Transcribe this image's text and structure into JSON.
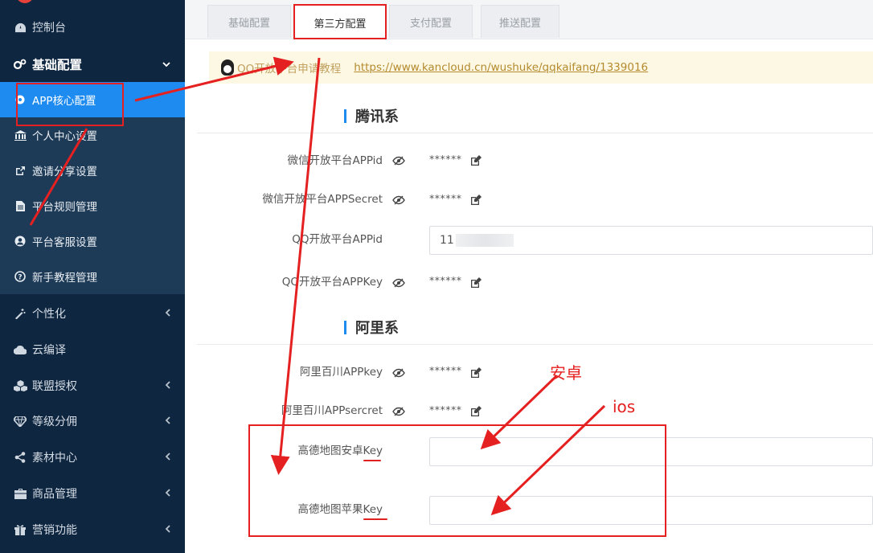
{
  "sidebar": {
    "items": [
      {
        "label": "控制台",
        "icon": "dashboard-icon"
      },
      {
        "label": "基础配置",
        "icon": "gears-icon"
      },
      {
        "label": "APP核心配置",
        "icon": "circle-icon"
      },
      {
        "label": "个人中心设置",
        "icon": "bank-icon"
      },
      {
        "label": "邀请分享设置",
        "icon": "share-square-icon"
      },
      {
        "label": "平台规则管理",
        "icon": "file-icon"
      },
      {
        "label": "平台客服设置",
        "icon": "user-circle-icon"
      },
      {
        "label": "新手教程管理",
        "icon": "question-circle-icon"
      },
      {
        "label": "个性化",
        "icon": "magic-wand-icon"
      },
      {
        "label": "云编译",
        "icon": "cloud-icon"
      },
      {
        "label": "联盟授权",
        "icon": "cubes-icon"
      },
      {
        "label": "等级分佣",
        "icon": "diamond-icon"
      },
      {
        "label": "素材中心",
        "icon": "share-alt-icon"
      },
      {
        "label": "商品管理",
        "icon": "briefcase-icon"
      },
      {
        "label": "营销功能",
        "icon": "gift-icon"
      }
    ]
  },
  "tabs": [
    "基础配置",
    "第三方配置",
    "支付配置",
    "推送配置"
  ],
  "notice": {
    "text": "QQ开放平台申请教程",
    "link": "https://www.kancloud.cn/wushuke/qqkaifang/1339016"
  },
  "sections": {
    "tencent": "腾讯系",
    "ali": "阿里系"
  },
  "fields": {
    "wechat_appid": {
      "label": "微信开放平台APPid",
      "masked": "******"
    },
    "wechat_secret": {
      "label": "微信开放平台APPSecret",
      "masked": "******"
    },
    "qq_appid": {
      "label": "QQ开放平台APPid",
      "value": "11"
    },
    "qq_appkey": {
      "label": "QQ开放平台APPKey",
      "masked": "******"
    },
    "baichuan_key": {
      "label": "阿里百川APPkey",
      "masked": "******"
    },
    "baichuan_secret": {
      "label": "阿里百川APPsercret",
      "masked": "******"
    },
    "amap_android": {
      "label": "高德地图安卓Key",
      "value": ""
    },
    "amap_ios": {
      "label": "高德地图苹果Key",
      "value": ""
    }
  },
  "annotations": {
    "android": "安卓",
    "ios": "ios"
  },
  "colors": {
    "sidebar_bg": "#0f2640",
    "active": "#1e8bf0",
    "annotation": "#e52020"
  }
}
